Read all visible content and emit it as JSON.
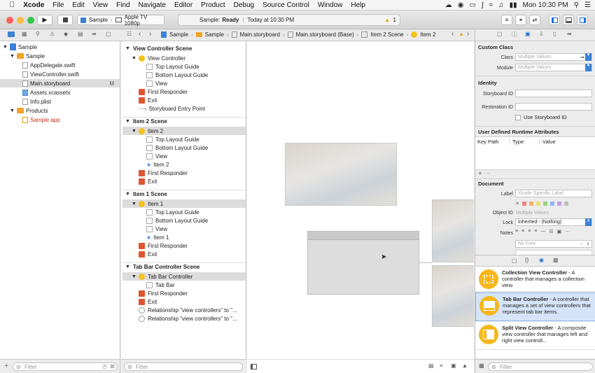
{
  "menubar": {
    "apple": "",
    "items": [
      "Xcode",
      "File",
      "Edit",
      "View",
      "Find",
      "Navigate",
      "Editor",
      "Product",
      "Debug",
      "Source Control",
      "Window",
      "Help"
    ],
    "clock": "Mon 10:30 PM"
  },
  "toolbar": {
    "scheme": "Sample",
    "device": "Apple TV 1080p",
    "status_project": "Sample:",
    "status_state": "Ready",
    "status_time": "Today at 10:30 PM",
    "warning_count": "1"
  },
  "jumpbar": {
    "crumbs": [
      "Sample",
      "Sample",
      "Main.storyboard",
      "Main.storyboard (Base)",
      "Item 2 Scene",
      "Item 2"
    ]
  },
  "navigator": {
    "rows": [
      {
        "label": "Sample",
        "badge": ""
      },
      {
        "label": "Sample",
        "badge": ""
      },
      {
        "label": "AppDelegate.swift",
        "badge": ""
      },
      {
        "label": "ViewController.swift",
        "badge": ""
      },
      {
        "label": "Main.storyboard",
        "badge": "M"
      },
      {
        "label": "Assets.xcassets",
        "badge": ""
      },
      {
        "label": "Info.plist",
        "badge": ""
      },
      {
        "label": "Products",
        "badge": ""
      },
      {
        "label": "Sample.app",
        "badge": ""
      }
    ],
    "filter_placeholder": "Filter"
  },
  "outline": {
    "scenes": [
      {
        "title": "View Controller Scene",
        "items": [
          "View Controller",
          "Top Layout Guide",
          "Bottom Layout Guide",
          "View",
          "First Responder",
          "Exit",
          "Storyboard Entry Point"
        ]
      },
      {
        "title": "Item 2 Scene",
        "items": [
          "Item 2",
          "Top Layout Guide",
          "Bottom Layout Guide",
          "View",
          "Item 2",
          "First Responder",
          "Exit"
        ]
      },
      {
        "title": "Item 1 Scene",
        "items": [
          "Item 1",
          "Top Layout Guide",
          "Bottom Layout Guide",
          "View",
          "Item 1",
          "First Responder",
          "Exit"
        ]
      },
      {
        "title": "Tab Bar Controller Scene",
        "items": [
          "Tab Bar Controller",
          "Tab Bar",
          "First Responder",
          "Exit",
          "Relationship \"view controllers\" to \"...",
          "Relationship \"view controllers\" to \"..."
        ]
      }
    ],
    "filter_placeholder": "Filter"
  },
  "inspector": {
    "custom_class_header": "Custom Class",
    "class_label": "Class",
    "class_value": "Multiple Values",
    "module_label": "Module",
    "module_value": "Multiple Values",
    "identity_header": "Identity",
    "storyboard_id_label": "Storyboard ID",
    "restoration_id_label": "Restoration ID",
    "use_storyboard_id": "Use Storyboard ID",
    "runtime_header": "User Defined Runtime Attributes",
    "col_keypath": "Key Path",
    "col_type": "Type",
    "col_value": "Value",
    "document_header": "Document",
    "label_label": "Label",
    "label_placeholder": "Xcode Specific Label",
    "object_id_label": "Object ID",
    "object_id_value": "Multiple Values",
    "lock_label": "Lock",
    "lock_value": "Inherited - (Nothing)",
    "notes_label": "Notes",
    "font_placeholder": "No Font"
  },
  "library": {
    "items": [
      {
        "name": "Collection View Controller",
        "desc": " - A controller that manages a collection view."
      },
      {
        "name": "Tab Bar Controller",
        "desc": " - A controller that manages a set of view controllers that represent tab bar items."
      },
      {
        "name": "Split View Controller",
        "desc": " - A composite view controller that manages left and right view controll..."
      }
    ],
    "filter_placeholder": "Filter"
  },
  "colors": {
    "accent": "#1f6fe0",
    "selection": "#d5e4f8",
    "folder": "#f2a32a"
  }
}
